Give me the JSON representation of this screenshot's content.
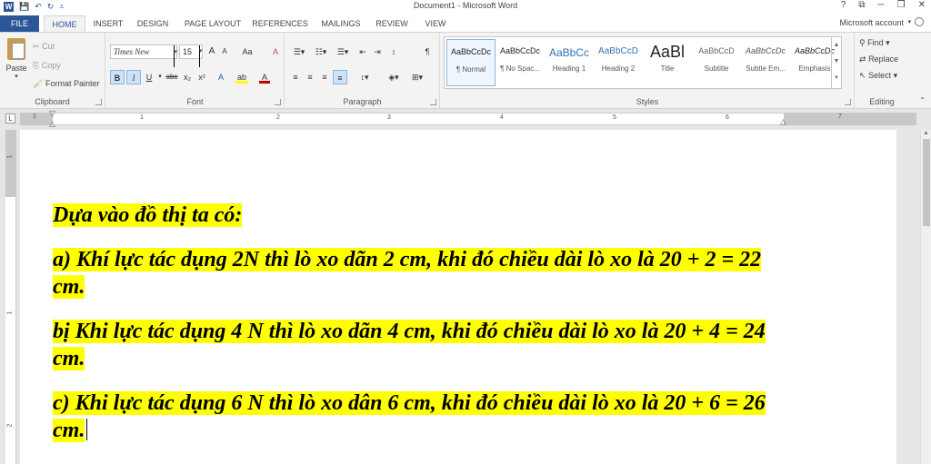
{
  "window": {
    "title": "Document1 - Microsoft Word",
    "controls": [
      "?",
      "⧉",
      "─",
      "❐",
      "✕"
    ]
  },
  "quick_access": {
    "app_icon": "W",
    "save_icon": "save-icon",
    "undo_icon": "undo-icon",
    "redo_icon": "redo-icon",
    "customize_icon": "customize-icon"
  },
  "tabs": [
    {
      "label": "FILE"
    },
    {
      "label": "HOME"
    },
    {
      "label": "INSERT"
    },
    {
      "label": "DESIGN"
    },
    {
      "label": "PAGE LAYOUT"
    },
    {
      "label": "REFERENCES"
    },
    {
      "label": "MAILINGS"
    },
    {
      "label": "REVIEW"
    },
    {
      "label": "VIEW"
    }
  ],
  "active_tab": "HOME",
  "account": "Microsoft account",
  "clipboard": {
    "label": "Clipboard",
    "paste": "Paste",
    "cut": "Cut",
    "copy": "Copy",
    "format_painter": "Format Painter"
  },
  "font": {
    "label": "Font",
    "font_name": "Times New",
    "font_size": "15",
    "grow": "A",
    "shrink": "A",
    "case": "Aa",
    "clear": "A",
    "bold": "B",
    "italic": "I",
    "underline": "U",
    "strike": "abc",
    "subscript": "x₂",
    "superscript": "x²",
    "effects": "A",
    "highlight": "ab",
    "color": "A"
  },
  "paragraph": {
    "label": "Paragraph",
    "pilcrow": "¶"
  },
  "styles": {
    "label": "Styles",
    "items": [
      {
        "sample": "AaBbCcDc",
        "name": "¶ Normal"
      },
      {
        "sample": "AaBbCcDc",
        "name": "¶ No Spac..."
      },
      {
        "sample": "AaBbCc",
        "name": "Heading 1"
      },
      {
        "sample": "AaBbCcD",
        "name": "Heading 2"
      },
      {
        "sample": "AaBl",
        "name": "Title"
      },
      {
        "sample": "AaBbCcD",
        "name": "Subtitle"
      },
      {
        "sample": "AaBbCcDc",
        "name": "Subtle Em..."
      },
      {
        "sample": "AaBbCcDc",
        "name": "Emphasis"
      }
    ]
  },
  "editing": {
    "label": "Editing",
    "find": "Find",
    "replace": "Replace",
    "select": "Select"
  },
  "ruler": {
    "corner": "L",
    "numbers": [
      "1",
      "1",
      "2",
      "3",
      "4",
      "5",
      "6",
      "7"
    ],
    "vnumbers": [
      "1",
      "1",
      "2"
    ]
  },
  "document": {
    "paragraphs": [
      "Dựa vào đồ thị ta có:",
      "a) Khí lực tác dụng 2N thì lò xo dãn 2 cm, khi đó chiều dài lò xo là 20 + 2 = 22 cm.",
      "bị Khi lực tác dụng 4 N thì lò xo dãn 4 cm, khi đó chiều dài lò xo là 20 + 4 = 24 cm.",
      "c) Khi lực tác dụng 6 N thì lò xo dân 6 cm, khi đó chiều dài lò xo là 20 + 6 = 26 cm."
    ]
  },
  "colors": {
    "accent": "#2b579a",
    "highlight": "#ffff00"
  }
}
